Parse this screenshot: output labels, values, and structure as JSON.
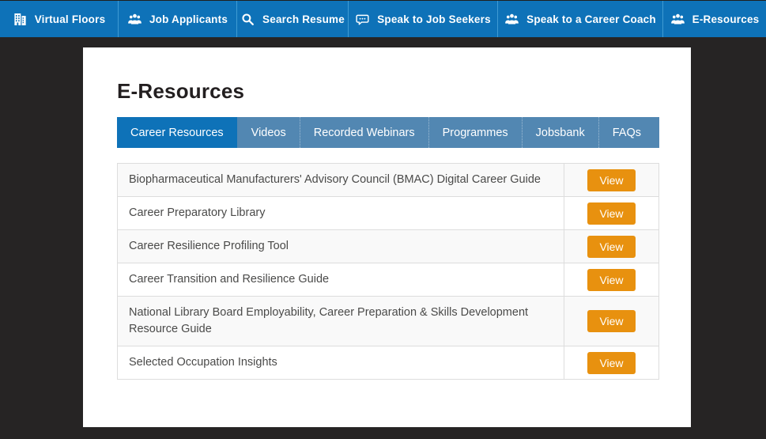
{
  "nav": {
    "items": [
      {
        "label": "Virtual Floors",
        "icon": "building-icon"
      },
      {
        "label": "Job Applicants",
        "icon": "people-icon"
      },
      {
        "label": "Search Resume",
        "icon": "search-icon"
      },
      {
        "label": "Speak to Job Seekers",
        "icon": "chat-icon"
      },
      {
        "label": "Speak to a Career Coach",
        "icon": "people-icon"
      },
      {
        "label": "E-Resources",
        "icon": "people-icon"
      }
    ]
  },
  "page": {
    "title": "E-Resources"
  },
  "tabs": [
    {
      "label": "Career Resources",
      "active": true
    },
    {
      "label": "Videos",
      "active": false
    },
    {
      "label": "Recorded Webinars",
      "active": false
    },
    {
      "label": "Programmes",
      "active": false
    },
    {
      "label": "Jobsbank",
      "active": false
    },
    {
      "label": "FAQs",
      "active": false
    }
  ],
  "resources": [
    {
      "title": "Biopharmaceutical Manufacturers' Advisory Council (BMAC) Digital Career Guide",
      "action": "View"
    },
    {
      "title": "Career Preparatory Library",
      "action": "View"
    },
    {
      "title": "Career Resilience Profiling Tool",
      "action": "View"
    },
    {
      "title": "Career Transition and Resilience Guide",
      "action": "View"
    },
    {
      "title": "National Library Board Employability, Career Preparation & Skills Development Resource Guide",
      "action": "View"
    },
    {
      "title": "Selected Occupation Insights",
      "action": "View"
    }
  ],
  "colors": {
    "nav_blue": "#0e72b8",
    "nav_divider": "#3f9bd3",
    "tab_bar_background": "#5287b2",
    "active_tab": "#0e72b8",
    "view_button_orange": "#e8910f",
    "page_background": "#262424",
    "row_stripe": "#f9f9f9",
    "table_border": "#dddddd"
  }
}
